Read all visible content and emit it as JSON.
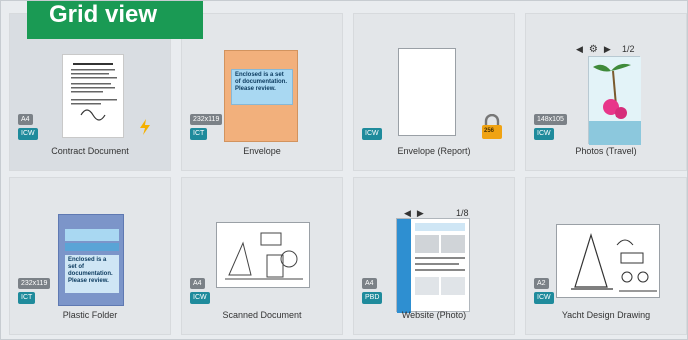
{
  "banner": {
    "title": "Grid view"
  },
  "items": [
    {
      "caption": "Contract Document",
      "size": "A4",
      "format": "ICW"
    },
    {
      "caption": "Envelope",
      "size": "232x119",
      "format": "ICT"
    },
    {
      "caption": "Envelope (Report)",
      "format": "ICW"
    },
    {
      "caption": "Photos (Travel)",
      "size": "148x105",
      "format": "ICW",
      "page": "1/2"
    },
    {
      "caption": "Plastic Folder",
      "size": "232x119",
      "format": "ICT"
    },
    {
      "caption": "Scanned Document",
      "size": "A4",
      "format": "ICW"
    },
    {
      "caption": "Website (Photo)",
      "size": "A4",
      "format": "PBD",
      "page": "1/8"
    },
    {
      "caption": "Yacht Design Drawing",
      "size": "A2",
      "format": "ICW"
    }
  ],
  "overlay_text": {
    "envelope_text": "Enclosed is a set of documentation. Please review.",
    "plastic_folder_text": "Enclosed is a set of documentation. Please review.",
    "lock_label": "256"
  },
  "colors": {
    "banner": "#1a9a54",
    "format_badge": "#1f8b9c",
    "size_badge": "#7b8187",
    "envelope_orange": "#f2b07c",
    "highlight_blue": "#a9d8f2"
  }
}
